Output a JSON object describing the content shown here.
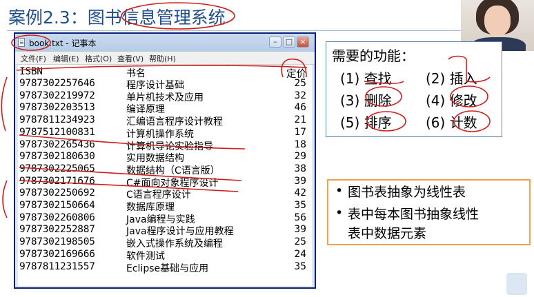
{
  "slide": {
    "title": "案例2.3：图书信息管理系统"
  },
  "notepad": {
    "title": "book.txt - 记事本",
    "menu": [
      "文件(F)",
      "编辑(E)",
      "格式(O)",
      "查看(V)",
      "帮助(H)"
    ],
    "window_buttons": [
      "–",
      "□",
      "×"
    ],
    "header": {
      "isbn": "ISBN",
      "name": "书名",
      "price": "定价"
    },
    "rows": [
      {
        "isbn": "9787302257646",
        "name": "程序设计基础",
        "price": "25"
      },
      {
        "isbn": "9787302219972",
        "name": "单片机技术及应用",
        "price": "32"
      },
      {
        "isbn": "9787302203513",
        "name": "编译原理",
        "price": "46"
      },
      {
        "isbn": "9787811234923",
        "name": "汇编语言程序设计教程",
        "price": "21"
      },
      {
        "isbn": "9787512100831",
        "name": "计算机操作系统",
        "price": "17"
      },
      {
        "isbn": "9787302265436",
        "name": "计算机导论实验指导",
        "price": "18"
      },
      {
        "isbn": "9787302180630",
        "name": "实用数据结构",
        "price": "29"
      },
      {
        "isbn": "9787302225065",
        "name": "数据结构（C语言版）",
        "price": "38"
      },
      {
        "isbn": "9787302171676",
        "name": "C#面向对象程序设计",
        "price": "39"
      },
      {
        "isbn": "9787302250692",
        "name": "C语言程序设计",
        "price": "42"
      },
      {
        "isbn": "9787302150664",
        "name": "数据库原理",
        "price": "35"
      },
      {
        "isbn": "9787302260806",
        "name": "Java编程与实践",
        "price": "56"
      },
      {
        "isbn": "9787302252887",
        "name": "Java程序设计与应用教程",
        "price": "39"
      },
      {
        "isbn": "9787302198505",
        "name": "嵌入式操作系统及编程",
        "price": "25"
      },
      {
        "isbn": "9787302169666",
        "name": "软件测试",
        "price": "24"
      },
      {
        "isbn": "9787811231557",
        "name": "Eclipse基础与应用",
        "price": "35"
      }
    ]
  },
  "functions": {
    "heading": "需要的功能：",
    "items": [
      "(1) 查找",
      "(2) 插入",
      "(3) 删除",
      "(4) 修改",
      "(5) 排序",
      "(6) 计数"
    ]
  },
  "bullets": {
    "items": [
      "图书表抽象为线性表",
      "表中每本图书抽象线性",
      "表中数据元素"
    ]
  },
  "colors": {
    "title": "#1f4e8c",
    "annotation": "#cf1c1c",
    "box_border_orange": "#f0a24a",
    "box_border_blue": "#5a7fb4"
  }
}
